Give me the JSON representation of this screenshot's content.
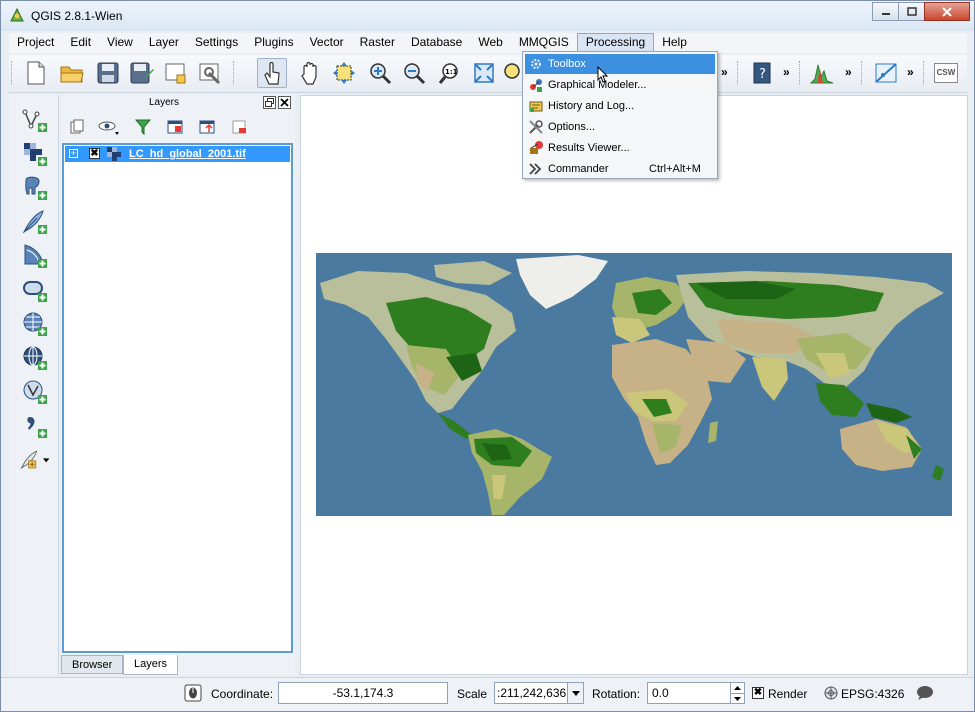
{
  "window": {
    "title": "QGIS 2.8.1-Wien",
    "controls": [
      "minimize-icon",
      "maximize-icon",
      "close-icon"
    ]
  },
  "menubar": {
    "items": [
      "Project",
      "Edit",
      "View",
      "Layer",
      "Settings",
      "Plugins",
      "Vector",
      "Raster",
      "Database",
      "Web",
      "MMQGIS",
      "Processing",
      "Help"
    ],
    "active": "Processing"
  },
  "processing_menu": {
    "items": [
      {
        "label": "Toolbox",
        "icon": "gear-icon",
        "shortcut": "",
        "highlighted": true
      },
      {
        "label": "Graphical Modeler...",
        "icon": "modeler-icon",
        "shortcut": "",
        "highlighted": false
      },
      {
        "label": "History and Log...",
        "icon": "history-icon",
        "shortcut": "",
        "highlighted": false
      },
      {
        "label": "Options...",
        "icon": "tools-icon",
        "shortcut": "",
        "highlighted": false
      },
      {
        "label": "Results Viewer...",
        "icon": "results-icon",
        "shortcut": "",
        "highlighted": false
      },
      {
        "label": "Commander",
        "icon": "commander-icon",
        "shortcut": "Ctrl+Alt+M",
        "highlighted": false
      }
    ]
  },
  "toolbar": {
    "csw_label": "CSW",
    "more_glyph": "»"
  },
  "layers_panel": {
    "title": "Layers",
    "layers": [
      {
        "name": "LC_hd_global_2001.tif",
        "visible": true,
        "checkbox_glyph": "✖"
      }
    ],
    "tabs": [
      "Browser",
      "Layers"
    ],
    "active_tab": "Layers"
  },
  "statusbar": {
    "coordinate_label": "Coordinate:",
    "coordinate_value": "-53.1,174.3",
    "scale_label": "Scale",
    "scale_value": ":211,242,636",
    "rotation_label": "Rotation:",
    "rotation_value": "0.0",
    "render_label": "Render",
    "render_checked": true,
    "render_checkbox_glyph": "✖",
    "crs_label": "EPSG:4326"
  },
  "colors": {
    "ocean": "#4a7aa0",
    "forest": "#2e7d1e",
    "dense_forest": "#1d6514",
    "grassland": "#cbc77a",
    "shrubland": "#a7b56b",
    "desert": "#c7b288",
    "tundra": "#b9bf9a",
    "ice": "#eeeeea",
    "highlight": "#3d8fe0"
  }
}
